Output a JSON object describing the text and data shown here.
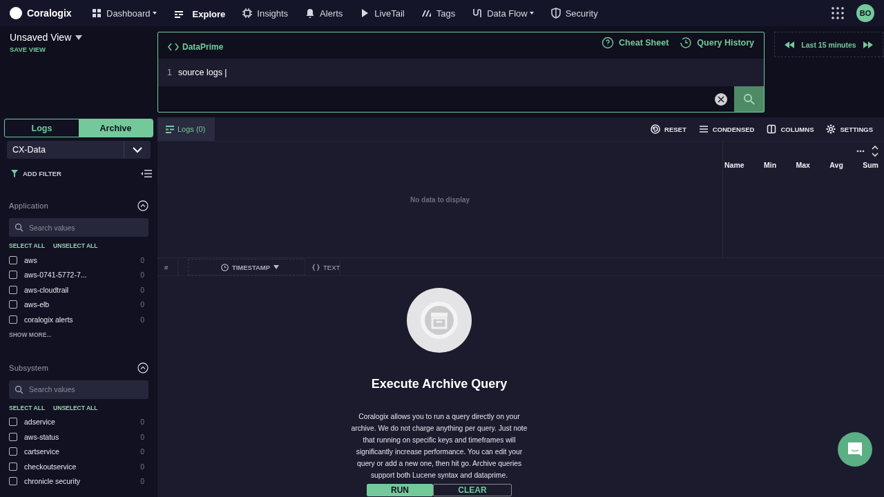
{
  "brand": {
    "name": "Coralogix"
  },
  "nav": [
    {
      "label": "Dashboard",
      "selected": false,
      "has_menu": true
    },
    {
      "label": "Explore",
      "selected": true,
      "has_menu": false
    },
    {
      "label": "Insights",
      "selected": false,
      "has_menu": false
    },
    {
      "label": "Alerts",
      "selected": false,
      "has_menu": false
    },
    {
      "label": "LiveTail",
      "selected": false,
      "has_menu": false
    },
    {
      "label": "Tags",
      "selected": false,
      "has_menu": false
    },
    {
      "label": "Data Flow",
      "selected": false,
      "has_menu": true
    },
    {
      "label": "Security",
      "selected": false,
      "has_menu": false
    }
  ],
  "user": {
    "initials": "BO"
  },
  "view": {
    "title": "Unsaved View",
    "save": "SAVE VIEW"
  },
  "query": {
    "language": "DataPrime",
    "links": [
      "Cheat Sheet",
      "Query History"
    ],
    "lines": [
      {
        "number": "1",
        "text": "source logs |"
      }
    ]
  },
  "time_range": {
    "label": "Last 15 minutes"
  },
  "source_tabs": [
    {
      "label": "Logs",
      "selected": false
    },
    {
      "label": "Archive",
      "selected": true
    }
  ],
  "dataset": {
    "value": "CX-Data"
  },
  "add_filter": "ADD FILTER",
  "filter_groups": [
    {
      "title": "Application",
      "expanded": true,
      "search_placeholder": "Search values",
      "select_all": "SELECT ALL",
      "unselect_all": "UNSELECT ALL",
      "show_more": "SHOW MORE...",
      "items": [
        {
          "label": "aws",
          "count": "0",
          "checked": false
        },
        {
          "label": "aws-0741-5772-7...",
          "count": "0",
          "checked": false
        },
        {
          "label": "aws-cloudtrail",
          "count": "0",
          "checked": false
        },
        {
          "label": "aws-elb",
          "count": "0",
          "checked": false
        },
        {
          "label": "coralogix alerts",
          "count": "0",
          "checked": false
        }
      ]
    },
    {
      "title": "Subsystem",
      "expanded": true,
      "search_placeholder": "Search values",
      "select_all": "SELECT ALL",
      "unselect_all": "UNSELECT ALL",
      "items": [
        {
          "label": "adservice",
          "count": "0",
          "checked": false
        },
        {
          "label": "aws-status",
          "count": "0",
          "checked": false
        },
        {
          "label": "cartservice",
          "count": "0",
          "checked": false
        },
        {
          "label": "checkoutservice",
          "count": "0",
          "checked": false
        },
        {
          "label": "chronicle security",
          "count": "0",
          "checked": false
        }
      ]
    }
  ],
  "results_tabs": [
    {
      "label": "Logs (0)",
      "selected": true
    }
  ],
  "toolbar": [
    "RESET",
    "CONDENSED",
    "COLUMNS",
    "SETTINGS"
  ],
  "chart": {
    "empty_text": "No data to display",
    "stats_columns": [
      "Name",
      "Min",
      "Max",
      "Avg",
      "Sum"
    ]
  },
  "grid": {
    "columns": [
      {
        "label": "#",
        "kind": "index"
      },
      {
        "label": "TIMESTAMP",
        "kind": "time"
      },
      {
        "label": "TEXT",
        "kind": "json"
      }
    ]
  },
  "empty_state": {
    "title": "Execute Archive Query",
    "body": "Coralogix allows you to run a query directly on your archive. We do not charge anything per query. Just note that running on specific keys and timeframes will significantly increase performance. You can edit your query or add a new one, then hit go. Archive queries support both Lucene syntax and dataprime.",
    "actions": [
      {
        "label": "RUN",
        "primary": true
      },
      {
        "label": "CLEAR",
        "primary": false
      }
    ]
  }
}
